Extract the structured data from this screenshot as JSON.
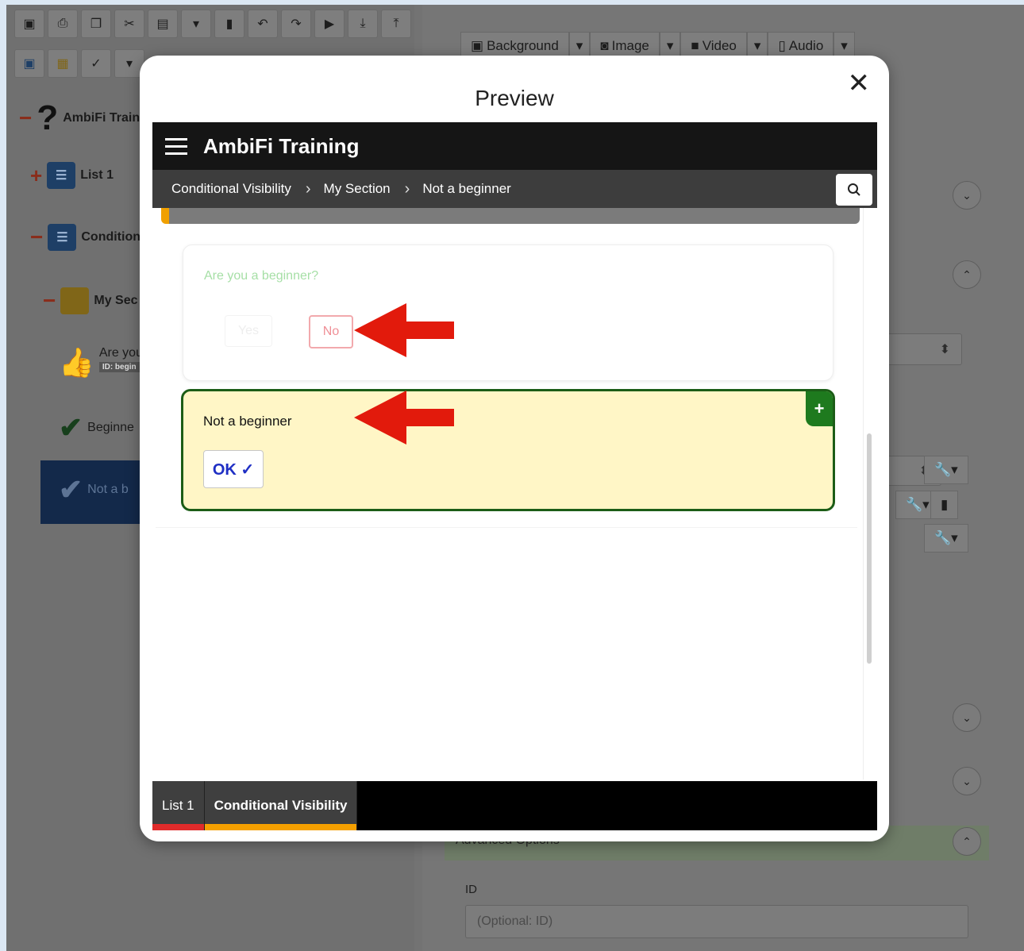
{
  "editor": {
    "tree": {
      "root": "AmbiFi Train",
      "list1": "List 1",
      "cond": "Condition",
      "section": "My Sec",
      "question": "Are you",
      "question_id": "ID: begin",
      "beginner": "Beginne",
      "not_beginner": "Not a b"
    },
    "media_buttons": [
      "Background",
      "Image",
      "Video",
      "Audio"
    ],
    "advanced_label": "Advanced Options",
    "id_label": "ID",
    "id_placeholder": "(Optional: ID)"
  },
  "modal": {
    "title": "Preview",
    "close_glyph": "✕"
  },
  "preview": {
    "app_title": "AmbiFi Training",
    "breadcrumbs": [
      "Conditional Visibility",
      "My Section",
      "Not a beginner"
    ],
    "question": "Are you a beginner?",
    "yes_label": "Yes",
    "no_label": "No",
    "result_title": "Not a beginner",
    "ok_label": "OK ✓",
    "tabs": [
      {
        "label": "List 1",
        "color": "#e02b2b"
      },
      {
        "label": "Conditional Visibility",
        "color": "#f5a000"
      }
    ]
  },
  "colors": {
    "arrow": "#e21a0c",
    "accent_green": "#1c5d17",
    "highlight_bg": "#fff6c6"
  }
}
